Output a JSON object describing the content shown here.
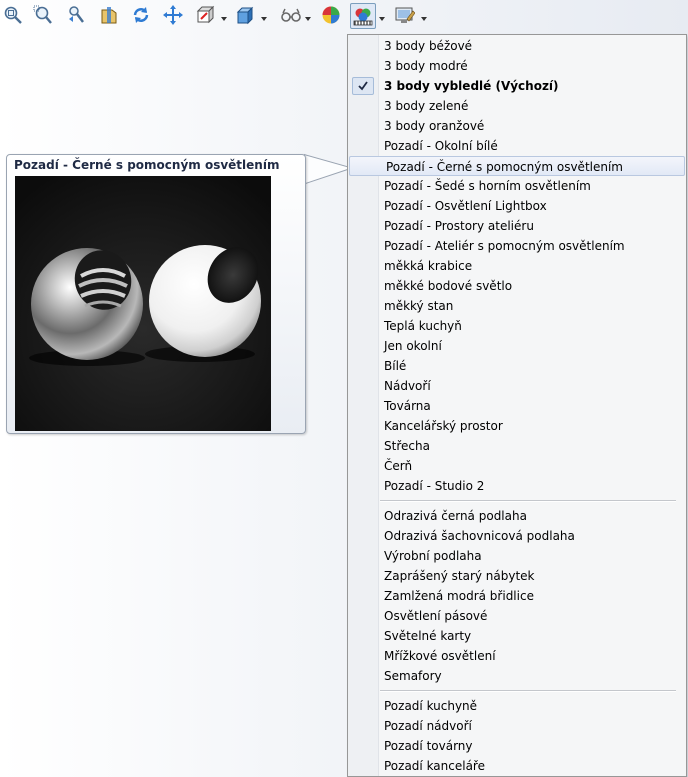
{
  "toolbar": {
    "icons": [
      "zoom-to-fit-icon",
      "zoom-to-area-icon",
      "previous-view-icon",
      "section-view-icon",
      "rotate-view-icon",
      "pan-icon",
      "view-orientation-icon",
      "display-style-icon",
      "hide-show-items-icon",
      "edit-appearance-icon",
      "apply-scene-icon",
      "view-settings-icon"
    ]
  },
  "menu": {
    "items": [
      {
        "label": "3 body béžové"
      },
      {
        "label": "3 body modré"
      },
      {
        "label": "3 body vybledlé  (Výchozí)",
        "checked": true
      },
      {
        "label": "3 body zelené"
      },
      {
        "label": "3 body oranžové"
      },
      {
        "label": "Pozadí - Okolní bílé"
      },
      {
        "label": "Pozadí - Černé s pomocným osvětlením",
        "highlighted": true
      },
      {
        "label": "Pozadí - Šedé s horním osvětlením"
      },
      {
        "label": "Pozadí - Osvětlení Lightbox"
      },
      {
        "label": "Pozadí - Prostory ateliéru"
      },
      {
        "label": "Pozadí - Ateliér s pomocným osvětlením"
      },
      {
        "label": "měkká krabice"
      },
      {
        "label": "měkké bodové světlo"
      },
      {
        "label": "měkký stan"
      },
      {
        "label": "Teplá kuchyň"
      },
      {
        "label": "Jen okolní"
      },
      {
        "label": "Bílé"
      },
      {
        "label": "Nádvoří"
      },
      {
        "label": "Továrna"
      },
      {
        "label": "Kancelářský prostor"
      },
      {
        "label": "Střecha"
      },
      {
        "label": "Čerň"
      },
      {
        "label": "Pozadí - Studio 2"
      },
      {
        "label": "Odrazivá černá podlaha"
      },
      {
        "label": "Odrazivá šachovnicová podlaha"
      },
      {
        "label": "Výrobní podlaha"
      },
      {
        "label": "Zaprášený starý nábytek"
      },
      {
        "label": "Zamlžená modrá břidlice"
      },
      {
        "label": "Osvětlení pásové"
      },
      {
        "label": "Světelné karty"
      },
      {
        "label": "Mřížkové osvětlení"
      },
      {
        "label": "Semafory"
      },
      {
        "label": "Pozadí kuchyně"
      },
      {
        "label": "Pozadí nádvoří"
      },
      {
        "label": "Pozadí továrny"
      },
      {
        "label": "Pozadí kanceláře"
      }
    ]
  },
  "tooltip": {
    "title": "Pozadí - Černé s pomocným osvětlením"
  },
  "colors": {
    "menu_bg": "#f5f6f7",
    "highlight_border": "#b9c8e0",
    "tooltip_title": "#1f2a44"
  }
}
